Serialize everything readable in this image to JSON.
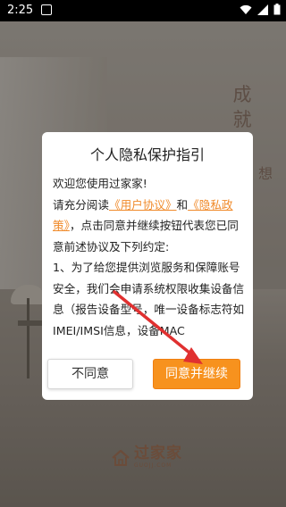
{
  "status_bar": {
    "time": "2:25",
    "icons": [
      "wifi-icon",
      "signal-icon",
      "battery-icon"
    ]
  },
  "background": {
    "vertical_text_1": "成就家的梦",
    "vertical_text_2": "想"
  },
  "dialog": {
    "title": "个人隐私保护指引",
    "greeting": "欢迎您使用过家家!",
    "para_prefix": "请充分阅读",
    "link_user_agreement": "《用户协议》",
    "conj": "和",
    "link_privacy_policy": "《隐私政策》",
    "para_suffix": "，点击同意并继续按钮代表您已同意前述协议及下列约定:",
    "item_1": "1、为了给您提供浏览服务和保障账号安全，我们会申请系统权限收集设备信息（报告设备型号，唯一设备标志符如IMEI/IMSI信息，设备MAC",
    "decline_label": "不同意",
    "accept_label": "同意并继续"
  },
  "logo": {
    "name": "过家家",
    "sub": "GUOJJ.COM"
  },
  "colors": {
    "accent": "#f7921e",
    "link": "#f08a2a",
    "annotation": "#e03030"
  }
}
